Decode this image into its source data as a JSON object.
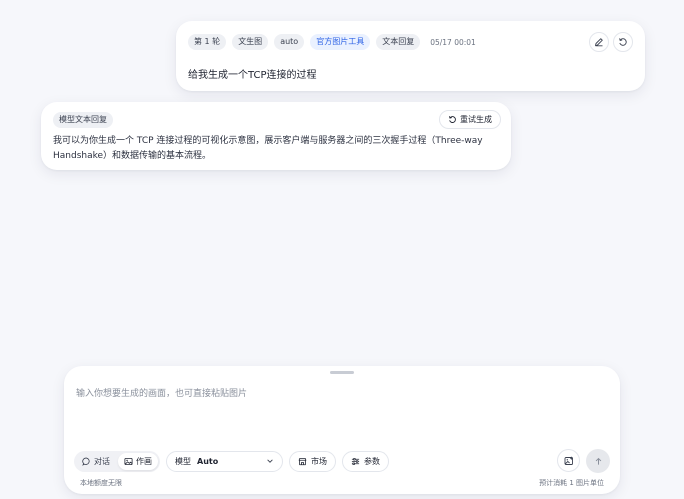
{
  "user_message": {
    "round": "第 1 轮",
    "tags": [
      "文生图",
      "auto"
    ],
    "tool_tag": "官方图片工具",
    "reply_type": "文本回复",
    "timestamp": "05/17 00:01",
    "text": "给我生成一个TCP连接的过程",
    "icons": [
      "edit-icon",
      "refresh-icon"
    ]
  },
  "assistant_message": {
    "badge": "模型文本回复",
    "regen_label": "重试生成",
    "text": "我可以为你生成一个 TCP 连接过程的可视化示意图，展示客户端与服务器之间的三次握手过程（Three-way Handshake）和数据传输的基本流程。"
  },
  "composer": {
    "placeholder": "输入你想要生成的画面，也可直接粘贴图片",
    "value": "",
    "modes": [
      {
        "label": "对话",
        "icon": "chat-bubble-icon",
        "active": false
      },
      {
        "label": "作画",
        "icon": "image-icon",
        "active": true
      }
    ],
    "model_label": "模型",
    "model_value": "Auto",
    "market_label": "市场",
    "params_label": "参数",
    "quota_text": "本地额度无限",
    "cost_text": "预计消耗 1 图片单位"
  },
  "colors": {
    "accent_blue": "#2e63e6",
    "background": "#f6f7fb",
    "card": "#ffffff"
  }
}
